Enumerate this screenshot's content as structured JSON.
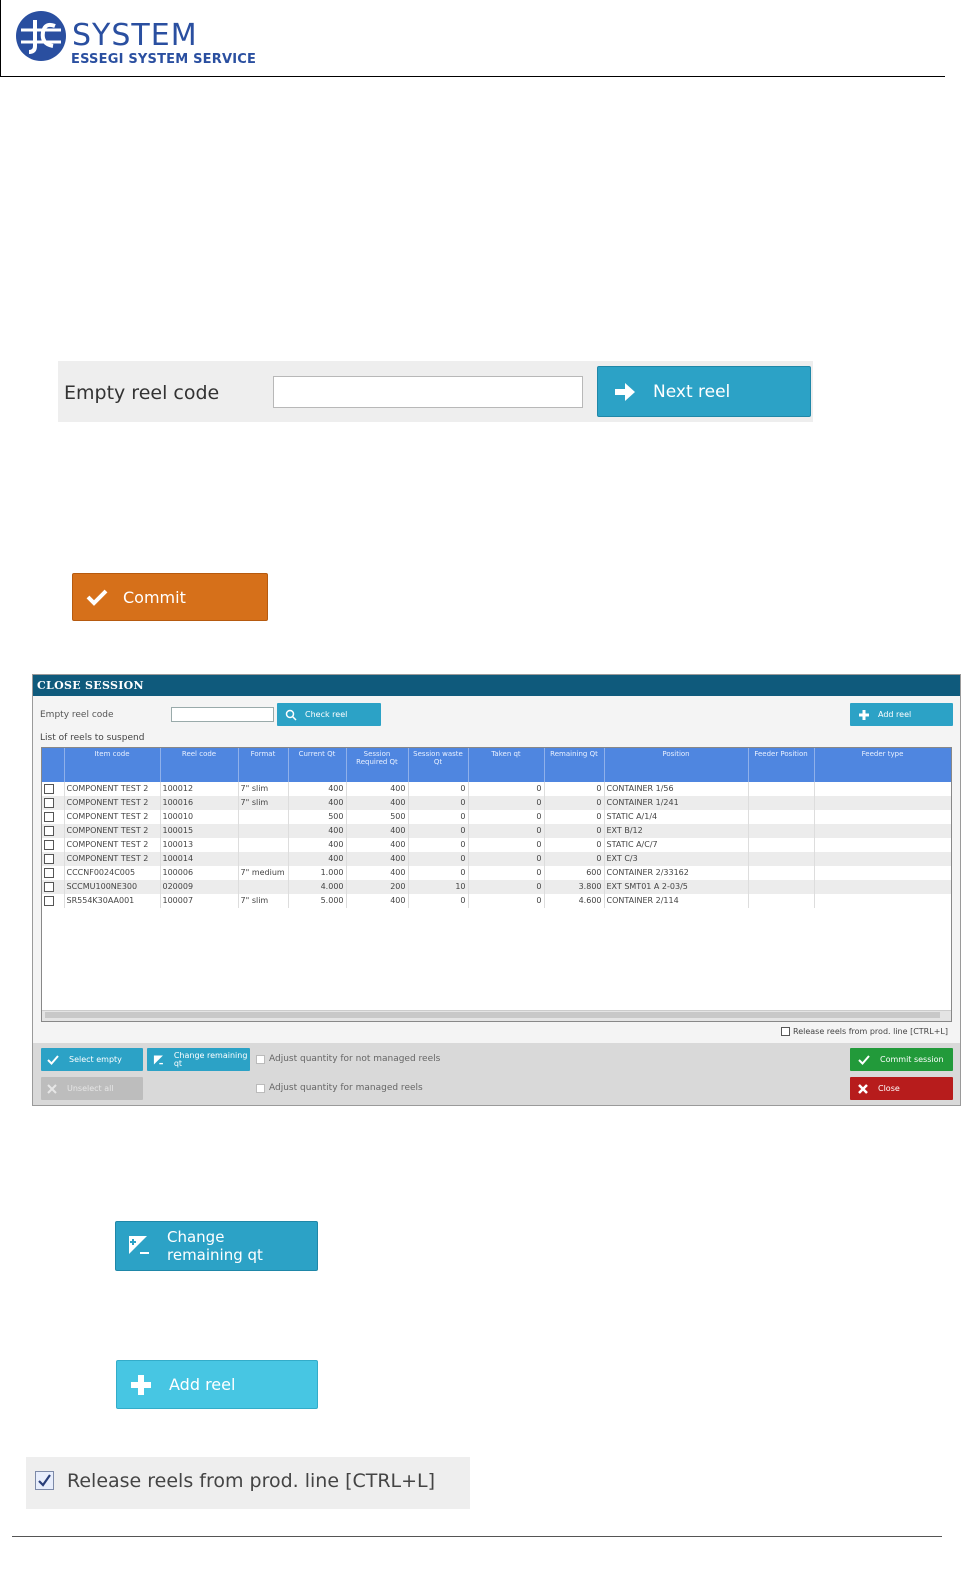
{
  "header": {
    "logo_word": "SYSTEM",
    "logo_sub": "ESSEGI SYSTEM SERVICE",
    "colors": {
      "brand": "#2a4fa0"
    }
  },
  "empty_reel_panel": {
    "label": "Empty reel code",
    "input_value": "",
    "next_reel_label": "Next reel",
    "next_reel_icon": "arrow-right-icon"
  },
  "commit_button": {
    "label": "Commit",
    "icon": "check-icon",
    "color": "#d6701a"
  },
  "dialog": {
    "title": "CLOSE SESSION",
    "empty_reel_label": "Empty reel code",
    "check_reel_label": "Check reel",
    "add_reel_label": "Add reel",
    "list_label": "List of reels to suspend",
    "columns": [
      "Item code",
      "Reel code",
      "Format",
      "Current Qt",
      "Session Required Qt",
      "Session waste Qt",
      "Taken qt",
      "Remaining Qt",
      "Position",
      "Feeder Position",
      "Feeder type"
    ],
    "rows": [
      [
        "COMPONENT TEST 2",
        "100012",
        "7\" slim",
        "400",
        "400",
        "0",
        "0",
        "0",
        "CONTAINER 1/56",
        "",
        ""
      ],
      [
        "COMPONENT TEST 2",
        "100016",
        "7\" slim",
        "400",
        "400",
        "0",
        "0",
        "0",
        "CONTAINER 1/241",
        "",
        ""
      ],
      [
        "COMPONENT TEST 2",
        "100010",
        "",
        "500",
        "500",
        "0",
        "0",
        "0",
        "STATIC A/1/4",
        "",
        ""
      ],
      [
        "COMPONENT TEST 2",
        "100015",
        "",
        "400",
        "400",
        "0",
        "0",
        "0",
        "EXT B/12",
        "",
        ""
      ],
      [
        "COMPONENT TEST 2",
        "100013",
        "",
        "400",
        "400",
        "0",
        "0",
        "0",
        "STATIC A/C/7",
        "",
        ""
      ],
      [
        "COMPONENT TEST 2",
        "100014",
        "",
        "400",
        "400",
        "0",
        "0",
        "0",
        "EXT C/3",
        "",
        ""
      ],
      [
        "CCCNF0024C005",
        "100006",
        "7\" medium",
        "1.000",
        "400",
        "0",
        "0",
        "600",
        "CONTAINER 2/33162",
        "",
        ""
      ],
      [
        "SCCMU100NE300",
        "020009",
        "",
        "4.000",
        "200",
        "10",
        "0",
        "3.800",
        "EXT SMT01 A 2-03/5",
        "",
        ""
      ],
      [
        "SR554K30AA001",
        "100007",
        "7\" slim",
        "5.000",
        "400",
        "0",
        "0",
        "4.600",
        "CONTAINER 2/114",
        "",
        ""
      ]
    ],
    "release_label": "Release reels from prod. line [CTRL+L]",
    "select_empty_label": "Select empty",
    "change_remaining_label": "Change remaining qt",
    "unselect_all_label": "Unselect all",
    "adjust_not_managed_label": "Adjust quantity for not managed reels",
    "adjust_managed_label": "Adjust quantity for managed reels",
    "commit_session_label": "Commit session",
    "close_label": "Close"
  },
  "change_remaining_button": {
    "line1": "Change",
    "line2": "remaining qt",
    "icon": "edit-quantity-icon"
  },
  "add_reel_button": {
    "label": "Add reel",
    "icon": "plus-icon"
  },
  "release_checkbox": {
    "label": "Release reels from prod. line [CTRL+L]",
    "checked": true
  }
}
